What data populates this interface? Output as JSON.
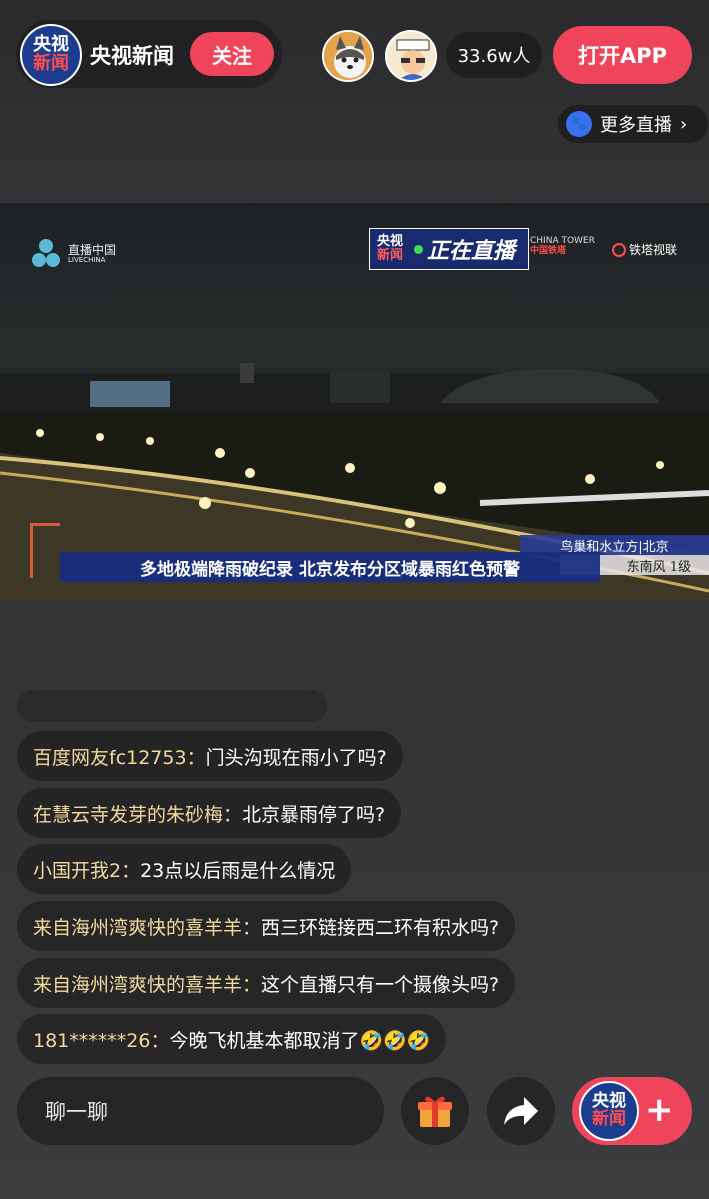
{
  "header": {
    "logo_line1": "央视",
    "logo_line2": "新闻",
    "anchor_name": "央视新闻",
    "follow_label": "关注",
    "viewer_count": "33.6w人",
    "open_app_label": "打开APP",
    "more_live_label": "更多直播"
  },
  "video": {
    "livechina_name": "直播中国",
    "livechina_sub": "LIVECHINA",
    "tag_line1": "央视",
    "tag_line2": "新闻",
    "tag_live": "正在直播",
    "tower_name": "CHINA TOWER",
    "tower_cn": "中国铁塔",
    "tiezhi": "铁塔视联",
    "headline": "多地极端降雨破纪录 北京发布分区域暴雨红色预警",
    "location": "鸟巢和水立方|北京",
    "wind": "东南风  1级"
  },
  "comments": [
    {
      "user": "百度网友fc12753：",
      "text": "门头沟现在雨小了吗?"
    },
    {
      "user": "在慧云寺发芽的朱砂梅：",
      "text": "北京暴雨停了吗?"
    },
    {
      "user": "小国开我2：",
      "text": "23点以后雨是什么情况"
    },
    {
      "user": "来自海州湾爽快的喜羊羊：",
      "text": "西三环链接西二环有积水吗?"
    },
    {
      "user": "来自海州湾爽快的喜羊羊：",
      "text": "这个直播只有一个摄像头吗?"
    },
    {
      "user": "181******26：",
      "text": "今晚飞机基本都取消了🤣🤣🤣"
    }
  ],
  "bottom": {
    "chat_placeholder": "聊一聊",
    "plus_logo_line1": "央视",
    "plus_logo_line2": "新闻",
    "plus_symbol": "+"
  },
  "colors": {
    "accent": "#f0445a",
    "brand_blue": "#1b3c8f",
    "username": "#f3d99c"
  },
  "icons": [
    "gift-icon",
    "share-icon",
    "paw-icon",
    "chevron-right-icon"
  ]
}
